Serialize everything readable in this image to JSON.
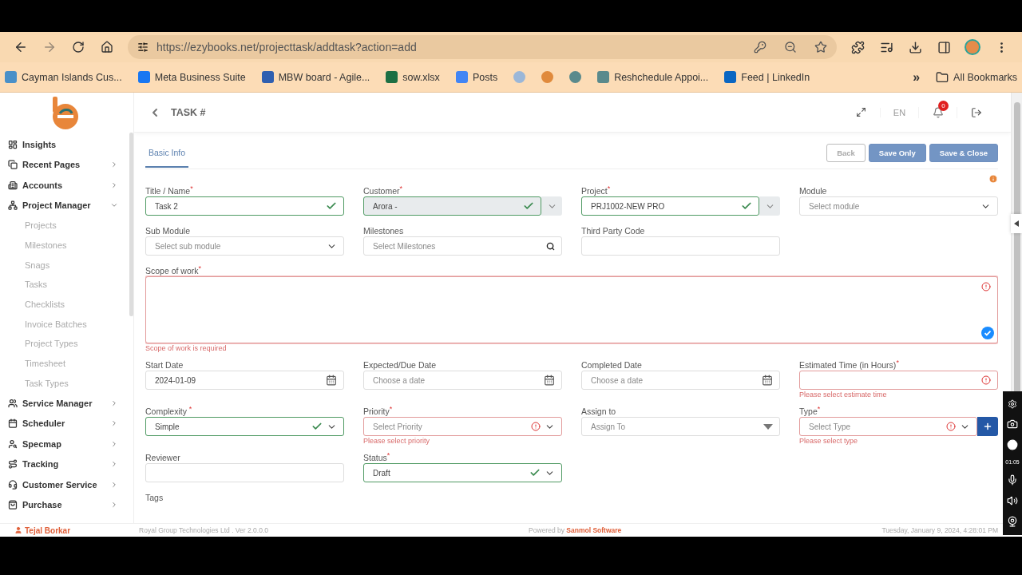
{
  "browser": {
    "url": "https://ezybooks.net/projecttask/addtask?action=add",
    "bookmarks": [
      {
        "kind": "link",
        "label": "Cayman Islands Cus...",
        "color": "#4a90c8"
      },
      {
        "kind": "link",
        "label": "Meta Business Suite",
        "color": "#1877f2"
      },
      {
        "kind": "link",
        "label": "MBW board - Agile...",
        "color": "#2f5fb0"
      },
      {
        "kind": "link",
        "label": "sow.xlsx",
        "color": "#1d7044"
      },
      {
        "kind": "link",
        "label": "Posts",
        "color": "#4285f4"
      },
      {
        "kind": "icon",
        "color": "#9bb7d8"
      },
      {
        "kind": "icon",
        "color": "#e08a3c"
      },
      {
        "kind": "icon",
        "color": "#5a8a8c"
      },
      {
        "kind": "link",
        "label": "Reshchedule Appoi...",
        "color": "#5a8a8c"
      },
      {
        "kind": "link",
        "label": "Feed | LinkedIn",
        "color": "#0a66c2"
      }
    ],
    "overflow": "»",
    "all_bookmarks": "All Bookmarks"
  },
  "sidebar": {
    "items": [
      {
        "kind": "link",
        "label": "Insights"
      },
      {
        "kind": "group",
        "label": "Recent Pages",
        "expanded": false
      },
      {
        "kind": "group",
        "label": "Accounts",
        "expanded": false
      },
      {
        "kind": "group",
        "label": "Project Manager",
        "expanded": true,
        "children": [
          {
            "label": "Projects"
          },
          {
            "label": "Milestones"
          },
          {
            "label": "Snags"
          },
          {
            "label": "Tasks"
          },
          {
            "label": "Checklists"
          },
          {
            "label": "Invoice Batches"
          },
          {
            "label": "Project Types"
          },
          {
            "label": "Timesheet"
          },
          {
            "label": "Task Types"
          }
        ]
      },
      {
        "kind": "group",
        "label": "Service Manager",
        "expanded": false
      },
      {
        "kind": "group",
        "label": "Scheduler",
        "expanded": false
      },
      {
        "kind": "group",
        "label": "Specmap",
        "expanded": false
      },
      {
        "kind": "group",
        "label": "Tracking",
        "expanded": false
      },
      {
        "kind": "group",
        "label": "Customer Service",
        "expanded": false
      },
      {
        "kind": "group",
        "label": "Purchase",
        "expanded": false
      }
    ],
    "user": "Tejal Borkar"
  },
  "header": {
    "title": "TASK #",
    "language": "EN",
    "notifications": "0"
  },
  "tabs": [
    {
      "label": "Basic Info",
      "selected": true
    }
  ],
  "buttons": [
    {
      "label": "Back",
      "kind": "outline"
    },
    {
      "label": "Save Only",
      "kind": "primary"
    },
    {
      "label": "Save & Close",
      "kind": "primary"
    }
  ],
  "form": {
    "rows": [
      [
        {
          "label": "Title / Name",
          "required_mark": "*",
          "kind": "text",
          "value": "Task 2",
          "valid": true,
          "invalid": false
        },
        {
          "label": "Customer",
          "required_mark": "*",
          "kind": "select",
          "value": "Arora -",
          "valid": true,
          "invalid": false,
          "disabled": true,
          "split_dropdown": true
        },
        {
          "label": "Project",
          "required_mark": "*",
          "kind": "select",
          "value": "PRJ1002-NEW PRO",
          "valid": true,
          "invalid": false,
          "split_dropdown": true
        },
        {
          "label": "Module",
          "kind": "select",
          "placeholder": "Select module",
          "valid": false,
          "invalid": false
        }
      ],
      [
        {
          "label": "Sub Module",
          "kind": "select",
          "placeholder": "Select sub module",
          "valid": false,
          "invalid": false
        },
        {
          "label": "Milestones",
          "kind": "search",
          "placeholder": "Select Milestones",
          "valid": false,
          "invalid": false
        },
        {
          "label": "Third Party Code",
          "kind": "text",
          "valid": false,
          "invalid": false
        }
      ],
      [
        {
          "label": "Scope of work",
          "required_mark": "*",
          "kind": "textarea",
          "valid": false,
          "invalid": true,
          "error": "Scope of work is required"
        }
      ],
      [
        {
          "label": "Start Date",
          "kind": "date",
          "value": "2024-01-09",
          "valid": false,
          "invalid": false
        },
        {
          "label": "Expected/Due Date",
          "kind": "date",
          "placeholder": "Choose a date",
          "valid": false,
          "invalid": false
        },
        {
          "label": "Completed Date",
          "kind": "date",
          "placeholder": "Choose a date",
          "valid": false,
          "invalid": false
        },
        {
          "label": "Estimated Time (in Hours)",
          "required_mark": "*",
          "kind": "text",
          "valid": false,
          "invalid": true,
          "error": "Please select estimate time"
        }
      ],
      [
        {
          "label": "Complexity ",
          "required_mark": "*",
          "kind": "select",
          "value": "Simple",
          "valid": true,
          "invalid": false
        },
        {
          "label": "Priority",
          "required_mark": "*",
          "kind": "select",
          "placeholder": "Select Priority",
          "valid": false,
          "invalid": true,
          "error": "Please select priority"
        },
        {
          "label": "Assign to",
          "kind": "combo",
          "placeholder": "Assign To",
          "valid": false,
          "invalid": false
        },
        {
          "label": "Type",
          "required_mark": "*",
          "kind": "select",
          "placeholder": "Select Type",
          "valid": false,
          "invalid": true,
          "error": "Please select type",
          "add_button": true
        }
      ],
      [
        {
          "label": "Reviewer",
          "kind": "text",
          "valid": false,
          "invalid": false
        },
        {
          "label": "Status",
          "required_mark": "*",
          "kind": "select",
          "value": "Draft",
          "valid": true,
          "invalid": false
        }
      ],
      [
        {
          "label": "Tags",
          "kind": "tags"
        }
      ]
    ]
  },
  "footer": {
    "company": "Royal Group Technologies Ltd . Ver 2.0.0.0",
    "powered_prefix": "Powered by",
    "powered_name": "Sanmol Software",
    "datetime": "Tuesday, January 9, 2024, 4:28:01 PM"
  },
  "recorder": {
    "time": "01:05"
  }
}
